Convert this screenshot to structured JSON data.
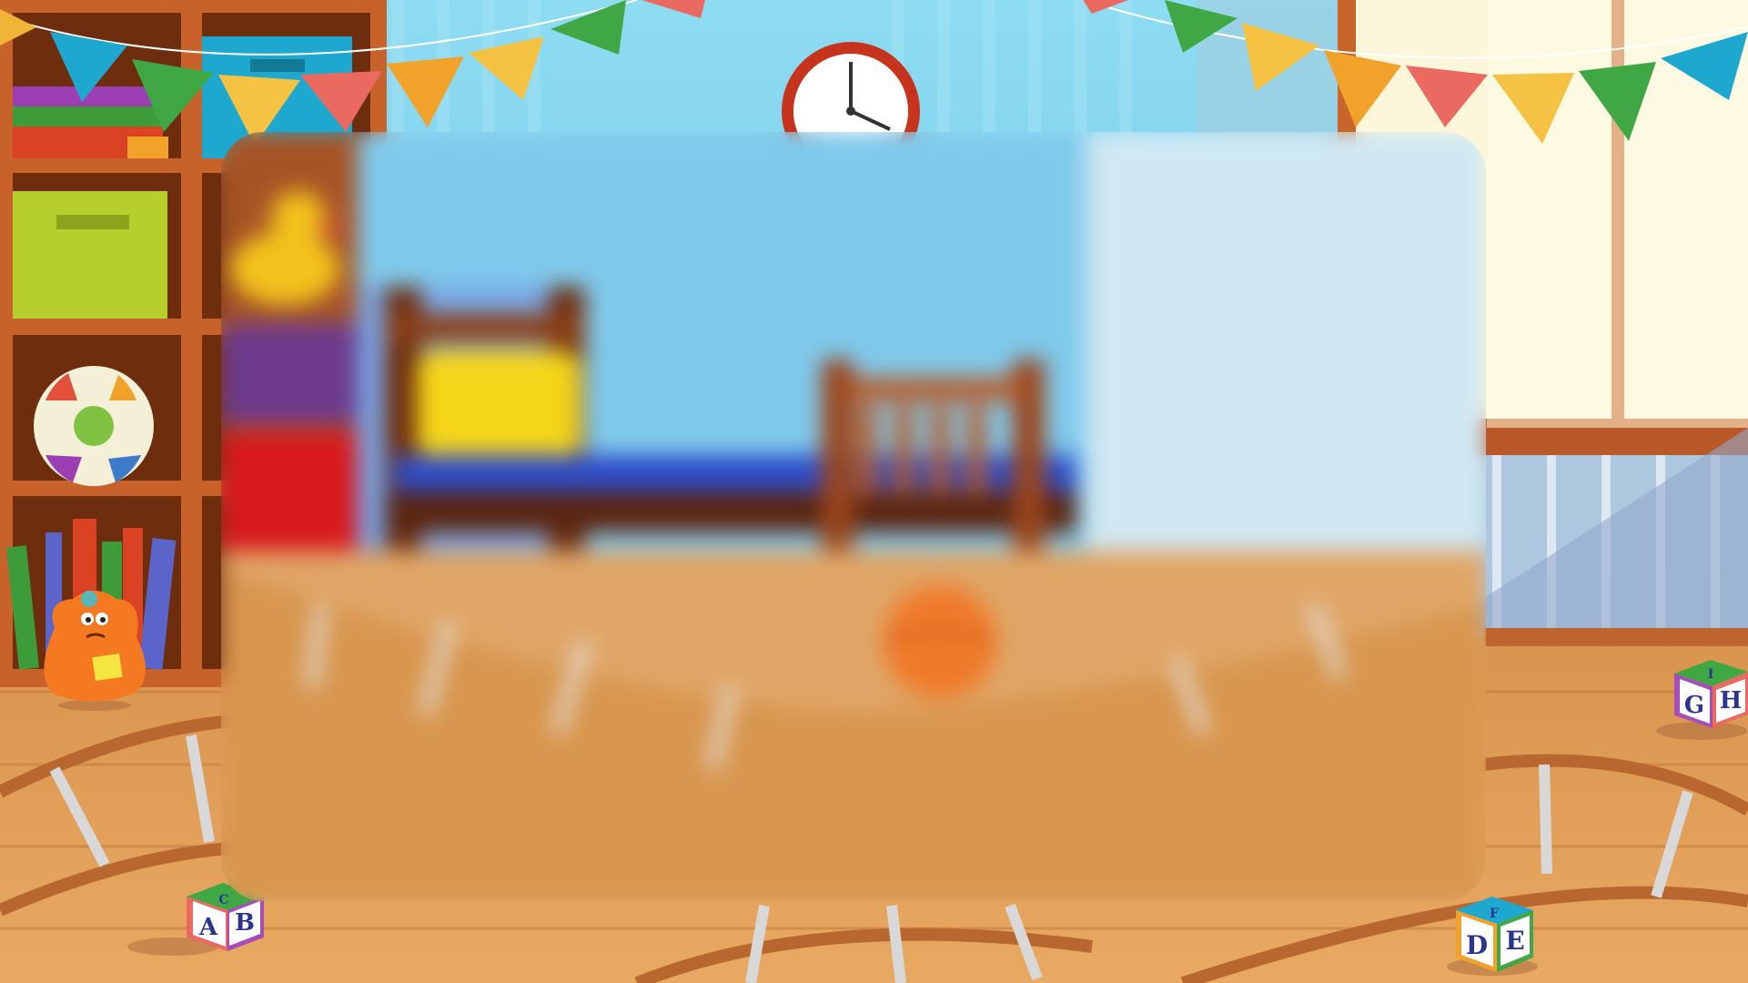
{
  "scene": {
    "colors": {
      "wall": "#8fd6ee",
      "curtain": "#6ec2e4",
      "shelf_wood": "#c7622a",
      "floor": "#d9944f",
      "track": "#b8682e",
      "window_light": "#fdf6da"
    },
    "icons": [
      "wall-clock-icon",
      "bunting-flags",
      "bookshelf",
      "soccer-ball-icon",
      "orange-fuzzy-character",
      "toy-train-track",
      "alphabet-block-icon",
      "bed",
      "basketball-icon",
      "rubber-duck-icon"
    ]
  },
  "blocks": {
    "left": {
      "front": "A",
      "side": "B",
      "top": "C"
    },
    "bottom_right": {
      "front": "D",
      "side": "E",
      "top": "F"
    },
    "right": {
      "front": "G",
      "side": "H",
      "top": "I"
    }
  }
}
